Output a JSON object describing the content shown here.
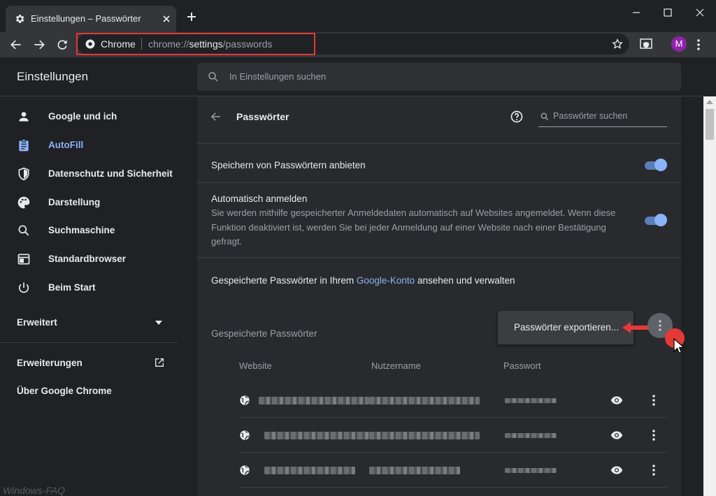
{
  "browser": {
    "tab_title": "Einstellungen – Passwörter",
    "omnibox_label": "Chrome",
    "url_scheme": "chrome://",
    "url_host": "settings",
    "url_path": "/passwords",
    "avatar_initial": "M"
  },
  "settings": {
    "title": "Einstellungen",
    "search_placeholder": "In Einstellungen suchen"
  },
  "sidebar": {
    "items": [
      {
        "label": "Google und ich",
        "icon": "person-icon"
      },
      {
        "label": "AutoFill",
        "icon": "assignment-icon",
        "active": true
      },
      {
        "label": "Datenschutz und Sicherheit",
        "icon": "shield-icon"
      },
      {
        "label": "Darstellung",
        "icon": "palette-icon"
      },
      {
        "label": "Suchmaschine",
        "icon": "search-icon"
      },
      {
        "label": "Standardbrowser",
        "icon": "browser-icon"
      },
      {
        "label": "Beim Start",
        "icon": "power-icon"
      }
    ],
    "advanced": "Erweitert",
    "extensions": "Erweiterungen",
    "about": "Über Google Chrome"
  },
  "passwords": {
    "title": "Passwörter",
    "search_placeholder": "Passwörter suchen",
    "offer_save": "Speichern von Passwörtern anbieten",
    "offer_save_enabled": true,
    "auto_signin": "Automatisch anmelden",
    "auto_signin_desc_1": "Sie werden mithilfe gespeicherter Anmeldedaten automatisch auf Websites angemeldet. Wenn diese",
    "auto_signin_desc_2": "Funktion deaktiviert ist, werden Sie bei jeder Anmeldung auf einer Website nach einer Bestätigung",
    "auto_signin_desc_3": "gefragt.",
    "auto_signin_enabled": true,
    "account_text_before": "Gespeicherte Passwörter in Ihrem",
    "account_link": "Google-Konto",
    "account_text_after": "ansehen und verwalten",
    "saved_heading": "Gespeicherte Passwörter",
    "export_menu_item": "Passwörter exportieren...",
    "columns": {
      "website": "Website",
      "username": "Nutzername",
      "password": "Passwort"
    }
  },
  "colors": {
    "accent": "#8ab4f8",
    "highlight": "#e53935",
    "background": "#202124",
    "card": "#292a2d"
  },
  "watermark": "Windows-FAQ"
}
